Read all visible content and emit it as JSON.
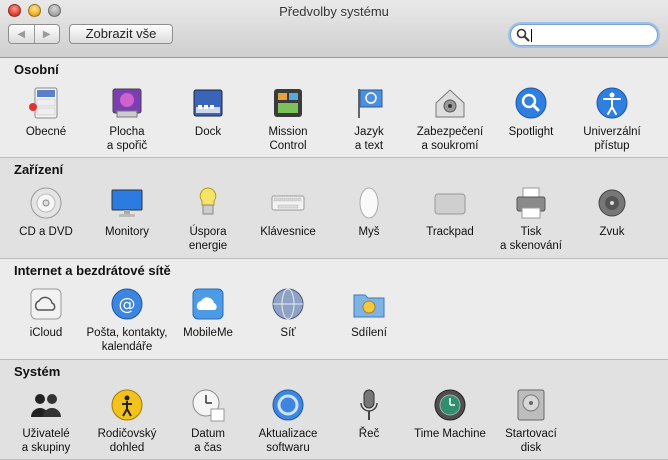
{
  "window": {
    "title": "Předvolby systému"
  },
  "toolbar": {
    "back_glyph": "◀",
    "forward_glyph": "▶",
    "show_all_label": "Zobrazit vše",
    "search": {
      "value": "",
      "placeholder": ""
    }
  },
  "sections": [
    {
      "title": "Osobní",
      "items": [
        {
          "label": "Obecné",
          "icon": "general-icon"
        },
        {
          "label": "Plocha\na spořič",
          "icon": "desktop-icon"
        },
        {
          "label": "Dock",
          "icon": "dock-icon"
        },
        {
          "label": "Mission\nControl",
          "icon": "mission-control-icon"
        },
        {
          "label": "Jazyk\na text",
          "icon": "language-icon"
        },
        {
          "label": "Zabezpečení\na soukromí",
          "icon": "security-icon"
        },
        {
          "label": "Spotlight",
          "icon": "spotlight-icon"
        },
        {
          "label": "Univerzální\npřístup",
          "icon": "accessibility-icon"
        }
      ]
    },
    {
      "title": "Zařízení",
      "items": [
        {
          "label": "CD a DVD",
          "icon": "cd-dvd-icon"
        },
        {
          "label": "Monitory",
          "icon": "displays-icon"
        },
        {
          "label": "Úspora\nenergie",
          "icon": "energy-saver-icon"
        },
        {
          "label": "Klávesnice",
          "icon": "keyboard-icon"
        },
        {
          "label": "Myš",
          "icon": "mouse-icon"
        },
        {
          "label": "Trackpad",
          "icon": "trackpad-icon"
        },
        {
          "label": "Tisk\na skenování",
          "icon": "printer-icon"
        },
        {
          "label": "Zvuk",
          "icon": "sound-icon"
        }
      ]
    },
    {
      "title": "Internet a bezdrátové sítě",
      "items": [
        {
          "label": "iCloud",
          "icon": "icloud-icon"
        },
        {
          "label": "Pošta, kontakty,\nkalendáře",
          "icon": "mail-contacts-icon"
        },
        {
          "label": "MobileMe",
          "icon": "mobileme-icon"
        },
        {
          "label": "Síť",
          "icon": "network-icon"
        },
        {
          "label": "Sdílení",
          "icon": "sharing-icon"
        }
      ]
    },
    {
      "title": "Systém",
      "items": [
        {
          "label": "Uživatelé\na skupiny",
          "icon": "users-icon"
        },
        {
          "label": "Rodičovský\ndohled",
          "icon": "parental-controls-icon"
        },
        {
          "label": "Datum\na čas",
          "icon": "date-time-icon"
        },
        {
          "label": "Aktualizace\nsoftwaru",
          "icon": "software-update-icon"
        },
        {
          "label": "Řeč",
          "icon": "speech-icon"
        },
        {
          "label": "Time Machine",
          "icon": "time-machine-icon"
        },
        {
          "label": "Startovací\ndisk",
          "icon": "startup-disk-icon"
        }
      ]
    }
  ],
  "colors": {
    "accent_blue": "#2f7fe0",
    "search_focus": "#9fc0ea",
    "window_bg": "#ececec",
    "section_alt_bg": "#e1e1e1"
  }
}
